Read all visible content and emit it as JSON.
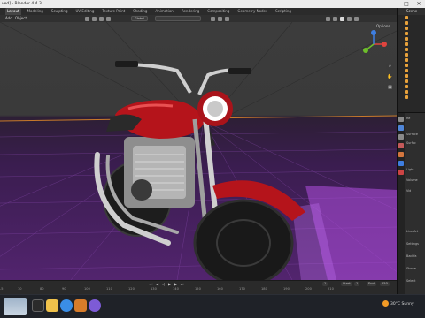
{
  "window": {
    "title": "ved] - Blender 4.4.3",
    "controls": [
      "minimize-icon",
      "maximize-icon",
      "close-icon"
    ]
  },
  "workspaces": {
    "tabs": [
      "Layout",
      "Modeling",
      "Sculpting",
      "UV Editing",
      "Texture Paint",
      "Shading",
      "Animation",
      "Rendering",
      "Compositing",
      "Geometry Nodes",
      "Scripting"
    ],
    "active": "Layout"
  },
  "viewport_header": {
    "menu_add": "Add",
    "menu_object": "Object",
    "orientation_dropdown": "Global",
    "options_label": "Options"
  },
  "viewport": {
    "background_upper": "#3b3b3b",
    "floor_color": "#5a2a7a",
    "horizon_line_color": "#c97a2a"
  },
  "timeline": {
    "ticks": [
      "-5",
      "70",
      "80",
      "90",
      "100",
      "110",
      "120",
      "130",
      "140",
      "150",
      "160",
      "170",
      "180",
      "190",
      "200",
      "210"
    ],
    "start_label": "Start",
    "start_value": "1",
    "end_label": "End",
    "end_value": "250",
    "current_frame": "1"
  },
  "right_panel": {
    "scene_label": "Scene",
    "properties_rows": [
      "Re",
      "Surface",
      "Surfac",
      "Light",
      "Volume",
      "Vid",
      "Line Art",
      "Settings",
      "Backfa",
      "Stroke",
      "Select"
    ]
  },
  "taskbar": {
    "weather": "30°C Sunny"
  }
}
